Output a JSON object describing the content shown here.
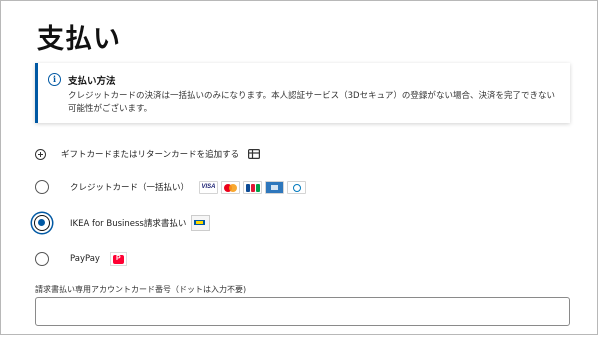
{
  "page": {
    "title": "支払い"
  },
  "notice": {
    "title": "支払い方法",
    "body": "クレジットカードの決済は一括払いのみになります。本人認証サービス（3Dセキュア）の登録がない場合、決済を完了できない可能性がございます。",
    "icon": "info-icon",
    "accent_color": "#0058a3"
  },
  "gift_card": {
    "label": "ギフトカードまたはリターンカードを追加する",
    "icon": "gift-card-icon"
  },
  "payment_options": [
    {
      "label": "クレジットカード（一括払い）",
      "selected": false,
      "logos": [
        "visa",
        "mastercard",
        "jcb",
        "amex",
        "diners"
      ]
    },
    {
      "label": "IKEA for Business請求書払い",
      "selected": true,
      "logos": [
        "ikea-business-card"
      ]
    },
    {
      "label": "PayPay",
      "selected": false,
      "logos": [
        "paypay"
      ]
    }
  ],
  "logos": {
    "visa": "VISA"
  },
  "account_field": {
    "label": "請求書払い専用アカウントカード番号（ドットは入力不要)",
    "value": ""
  }
}
